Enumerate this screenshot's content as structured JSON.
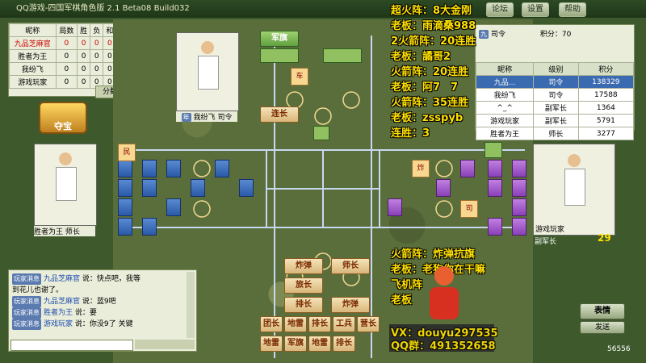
{
  "title_bar": {
    "title": "QQ游戏-四国军棋角色版 2.1 Beta08 Build032",
    "buttons": [
      "论坛",
      "设置",
      "帮助"
    ]
  },
  "scoreboard": {
    "headers": [
      "昵称",
      "局数",
      "胜",
      "负",
      "和",
      "总分"
    ],
    "rows": [
      [
        "九品芝麻官",
        "0",
        "0",
        "0",
        "0",
        "0"
      ],
      [
        "胜者为王",
        "0",
        "0",
        "0",
        "0",
        "0"
      ],
      [
        "我纷飞",
        "0",
        "0",
        "0",
        "0",
        "0"
      ],
      [
        "游戏玩家",
        "0",
        "0",
        "0",
        "0",
        "0"
      ]
    ],
    "stats_button": "分数统计",
    "treasure_label": "夺宝"
  },
  "players": {
    "top": {
      "name": "我纷飞",
      "rank": "司令",
      "badge": "年"
    },
    "left": {
      "name": "胜者为王",
      "rank": "师长"
    },
    "right": {
      "name": "游戏玩家",
      "rank": "副军长",
      "count": "29"
    }
  },
  "pieces_top": [
    "军旗",
    "车",
    "连长"
  ],
  "pieces_bottom": [
    "炸弹",
    "师长",
    "旅长",
    "排长",
    "炸弹",
    "团长",
    "地雷",
    "排长",
    "工兵",
    "营长",
    "地雷",
    "军旗",
    "地雷",
    "排长"
  ],
  "right_pieces": [
    "炸",
    "司"
  ],
  "roster": {
    "headers": [
      "昵称",
      "级别",
      "积分"
    ],
    "rows": [
      [
        "九品...",
        "司令",
        "138329"
      ],
      [
        "我纷飞",
        "司令",
        "17588"
      ],
      [
        "^_^",
        "副军长",
        "1364"
      ],
      [
        "游戏玩家",
        "副军长",
        "5791"
      ],
      [
        "胜者为王",
        "师长",
        "3277"
      ]
    ],
    "header_info": [
      "九",
      "司令",
      "积分",
      "70"
    ]
  },
  "chat": {
    "lines": [
      {
        "tag": "玩家消息",
        "user": "九品芝麻官",
        "text": "说：快点吧，我等"
      },
      {
        "tag": "",
        "user": "",
        "text": "到花儿也谢了。"
      },
      {
        "tag": "玩家消息",
        "user": "九品芝麻官",
        "text": "说：蓝9吧"
      },
      {
        "tag": "玩家消息",
        "user": "胜者为王",
        "text": "说：要"
      },
      {
        "tag": "玩家消息",
        "user": "游戏玩家",
        "text": "说：你没9了 关键"
      }
    ]
  },
  "buttons": {
    "emote": "表情",
    "send": "发送"
  },
  "overlay_top": [
    "超火阵：8大金刚",
    "老板：雨滴桑988",
    "2火箭阵：20连胜",
    "老板：譎哥2",
    "火箭阵：20连胜",
    "老板：阿7　7",
    "火箭阵：35连胜",
    "老板：zsspyb",
    "连胜：3"
  ],
  "overlay_bottom": [
    "火箭阵：炸弹抗旗",
    "老板：老狗你在干嘛",
    "飞机阵",
    "老板"
  ],
  "contact": {
    "vx": "VX：douyu297535",
    "qq": "QQ群：491352658"
  },
  "version": "56556"
}
